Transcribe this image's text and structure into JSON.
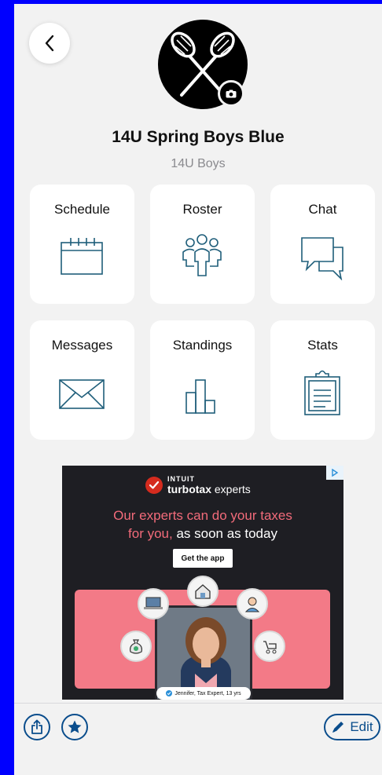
{
  "team": {
    "name": "14U Spring Boys Blue",
    "division": "14U Boys"
  },
  "tiles": [
    {
      "label": "Schedule",
      "icon": "calendar-icon"
    },
    {
      "label": "Roster",
      "icon": "people-icon"
    },
    {
      "label": "Chat",
      "icon": "chat-bubbles-icon"
    },
    {
      "label": "Messages",
      "icon": "envelope-icon"
    },
    {
      "label": "Standings",
      "icon": "bar-chart-icon"
    },
    {
      "label": "Stats",
      "icon": "clipboard-icon"
    }
  ],
  "ad": {
    "brand_top": "INTUIT",
    "brand_bold": "turbotax",
    "brand_rest": " experts",
    "headline_line1": "Our experts can do your taxes",
    "headline_line2a": "for you, ",
    "headline_line2b": "as soon as today",
    "cta": "Get the app",
    "caption": "Jennifer, Tax Expert, 13 yrs"
  },
  "toolbar": {
    "edit_label": "Edit"
  },
  "colors": {
    "accent": "#0A4D8C",
    "icon_stroke": "#1F5E7A",
    "background": "#F2F2F2",
    "frame": "#0000FF"
  }
}
